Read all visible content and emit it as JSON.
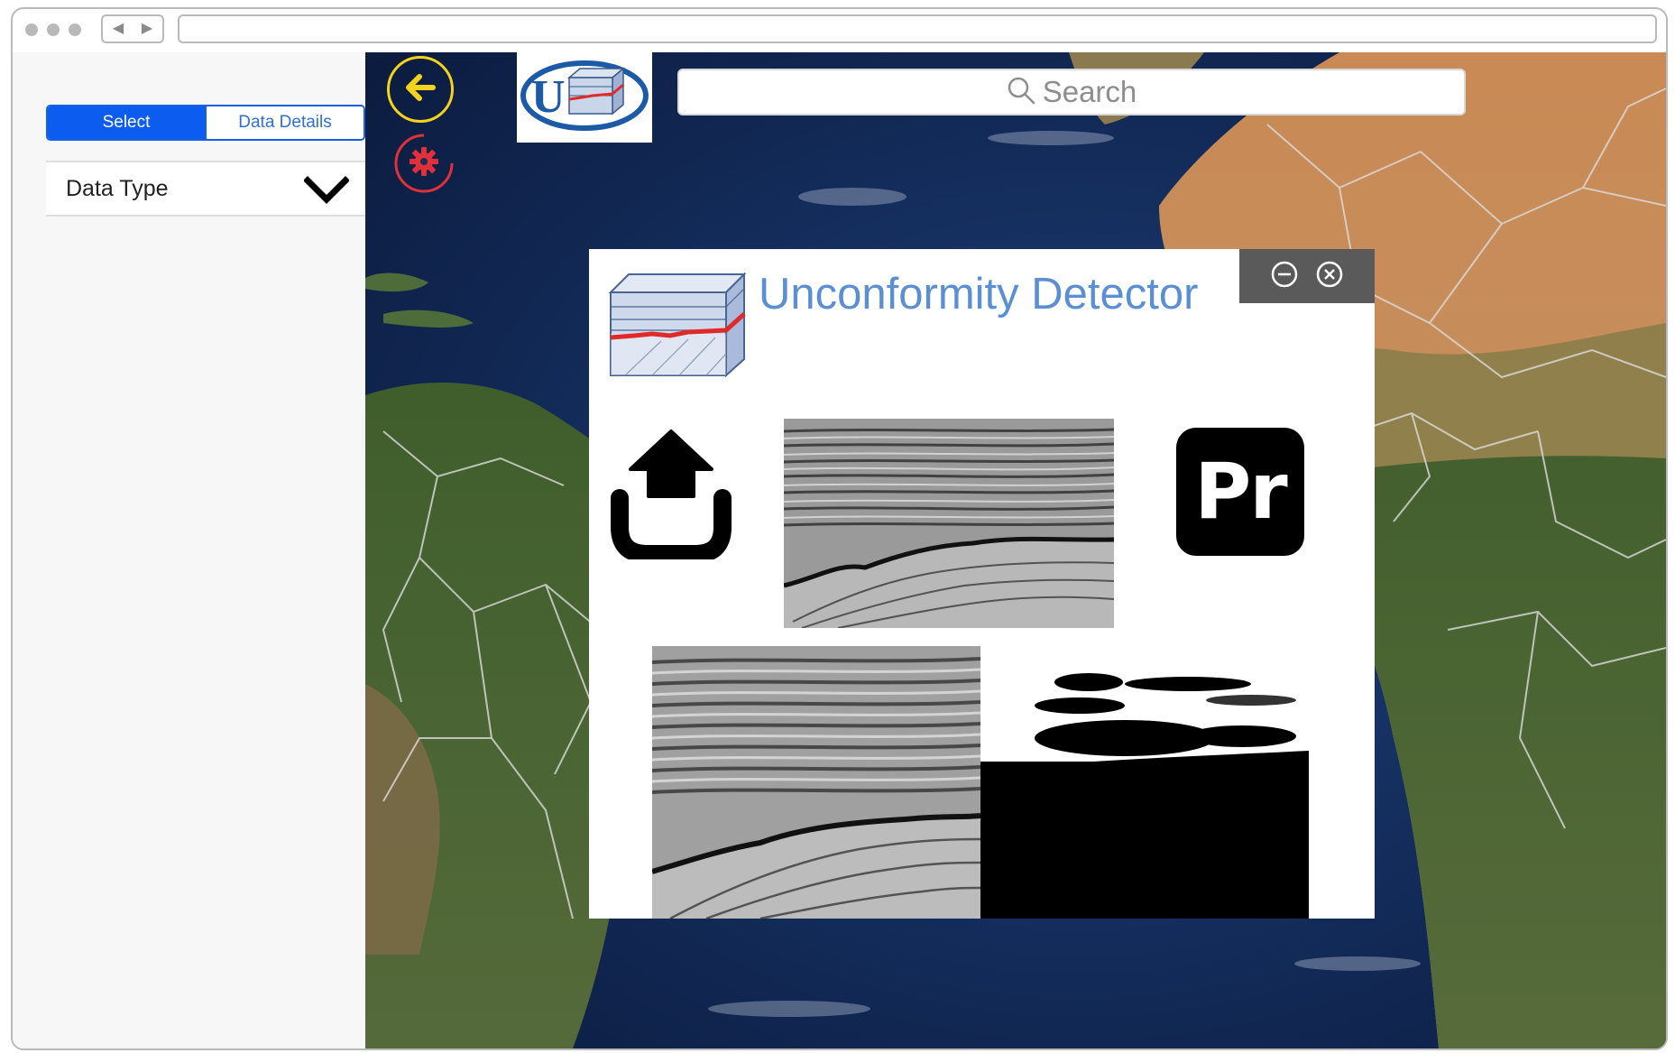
{
  "browser": {
    "nav_back_glyph": "◀",
    "nav_forward_glyph": "▶"
  },
  "sidebar": {
    "tabs": [
      {
        "label": "Select",
        "active": true
      },
      {
        "label": "Data Details",
        "active": false
      }
    ],
    "dropdown": {
      "label": "Data Type"
    }
  },
  "toolbar": {
    "back_icon": "arrow-left-icon",
    "settings_icon": "gear-icon",
    "search_placeholder": "Search"
  },
  "dialog": {
    "title": "Unconformity Detector",
    "app_badge": "Pr",
    "upload_icon": "upload-icon"
  },
  "colors": {
    "accent_blue": "#0c5cf0",
    "title_blue": "#5b8fd3",
    "back_button": "#f3d31b",
    "settings_button": "#e0303a",
    "dialog_controls": "#5a5a5a"
  }
}
